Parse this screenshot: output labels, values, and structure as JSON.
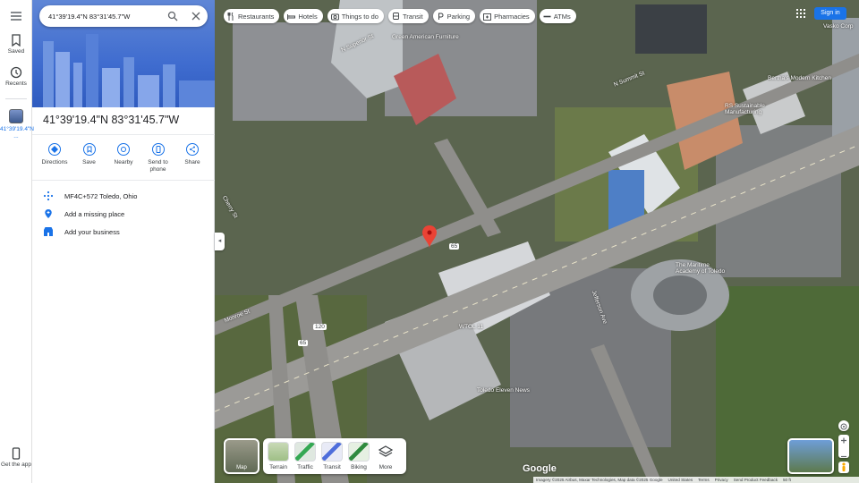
{
  "search": {
    "value": "41°39'19.4\"N 83°31'45.7\"W"
  },
  "rail": {
    "saved": "Saved",
    "recents": "Recents",
    "place_thumb": "41°39'19.4\"N ...",
    "get_app": "Get the app"
  },
  "place": {
    "title": "41°39'19.4\"N 83°31'45.7\"W",
    "actions": [
      "Directions",
      "Save",
      "Nearby",
      "Send to phone",
      "Share"
    ],
    "plus_code": "MF4C+572 Toledo, Ohio",
    "add_missing": "Add a missing place",
    "add_business": "Add your business"
  },
  "chips": [
    {
      "label": "Restaurants",
      "icon": "restaurant-icon"
    },
    {
      "label": "Hotels",
      "icon": "hotel-icon"
    },
    {
      "label": "Things to do",
      "icon": "camera-icon"
    },
    {
      "label": "Transit",
      "icon": "transit-icon"
    },
    {
      "label": "Parking",
      "icon": "parking-icon"
    },
    {
      "label": "Pharmacies",
      "icon": "pharmacy-icon"
    },
    {
      "label": "ATMs",
      "icon": "atm-icon"
    }
  ],
  "header": {
    "sign_in": "Sign in"
  },
  "layers": {
    "main": "Map",
    "items": [
      "Terrain",
      "Traffic",
      "Transit",
      "Biking",
      "More"
    ]
  },
  "map_labels": {
    "green_american": "Green American Furniture",
    "n_superior": "N Superior St",
    "n_summit": "N Summit St",
    "buttes": "Bertha's Modern Kitchen",
    "vasko": "Vasko Corp",
    "rs": "RS Sustainable Manufacturing",
    "maritime": "The Maritime Academy of Toledo",
    "wtol": "WTOL 11",
    "toledo_eleven": "Toledo Eleven News",
    "jefferson": "Jefferson Ave",
    "monroe": "Monroe St",
    "cherry": "Cherry St",
    "route_65": "65",
    "route_120": "120",
    "route_65b": "65"
  },
  "footer": {
    "google": "Google",
    "imagery": "Imagery ©2025 Airbus, Maxar Technologies, Map data ©2025 Google",
    "country": "United States",
    "terms": "Terms",
    "privacy": "Privacy",
    "feedback": "Send Product Feedback",
    "scale": "50 ft"
  },
  "colors": {
    "accent": "#1a73e8",
    "pin": "#ea4335"
  }
}
